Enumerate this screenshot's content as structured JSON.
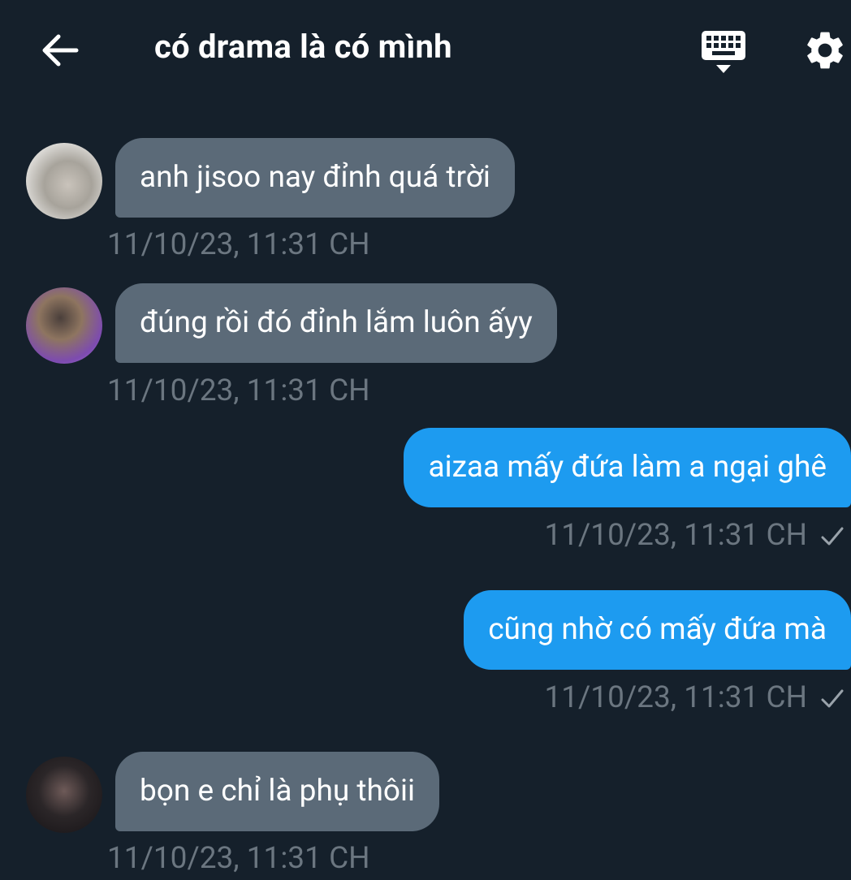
{
  "header": {
    "title": "có drama là có mình",
    "back_icon": "arrow-left-icon",
    "keyboard_icon": "keyboard-icon",
    "settings_icon": "gear-icon"
  },
  "messages": [
    {
      "direction": "incoming",
      "text": "anh jisoo nay đỉnh quá trời",
      "timestamp": "11/10/23, 11:31 CH"
    },
    {
      "direction": "incoming",
      "text": "đúng rồi đó đỉnh lắm luôn ấyy",
      "timestamp": "11/10/23, 11:31 CH"
    },
    {
      "direction": "outgoing",
      "text": "aizaa mấy đứa làm a ngại ghê",
      "timestamp": "11/10/23, 11:31 CH",
      "status_icon": "checkmark-icon"
    },
    {
      "direction": "outgoing",
      "text": "cũng nhờ có mấy đứa mà",
      "timestamp": "11/10/23, 11:31 CH",
      "status_icon": "checkmark-icon"
    },
    {
      "direction": "incoming",
      "text": "bọn e chỉ là phụ thôii",
      "timestamp": "11/10/23, 11:31 CH"
    }
  ],
  "colors": {
    "background": "#15202b",
    "incoming_bubble": "#5b6a78",
    "outgoing_bubble": "#1d9bf0",
    "timestamp": "#6b7680"
  }
}
